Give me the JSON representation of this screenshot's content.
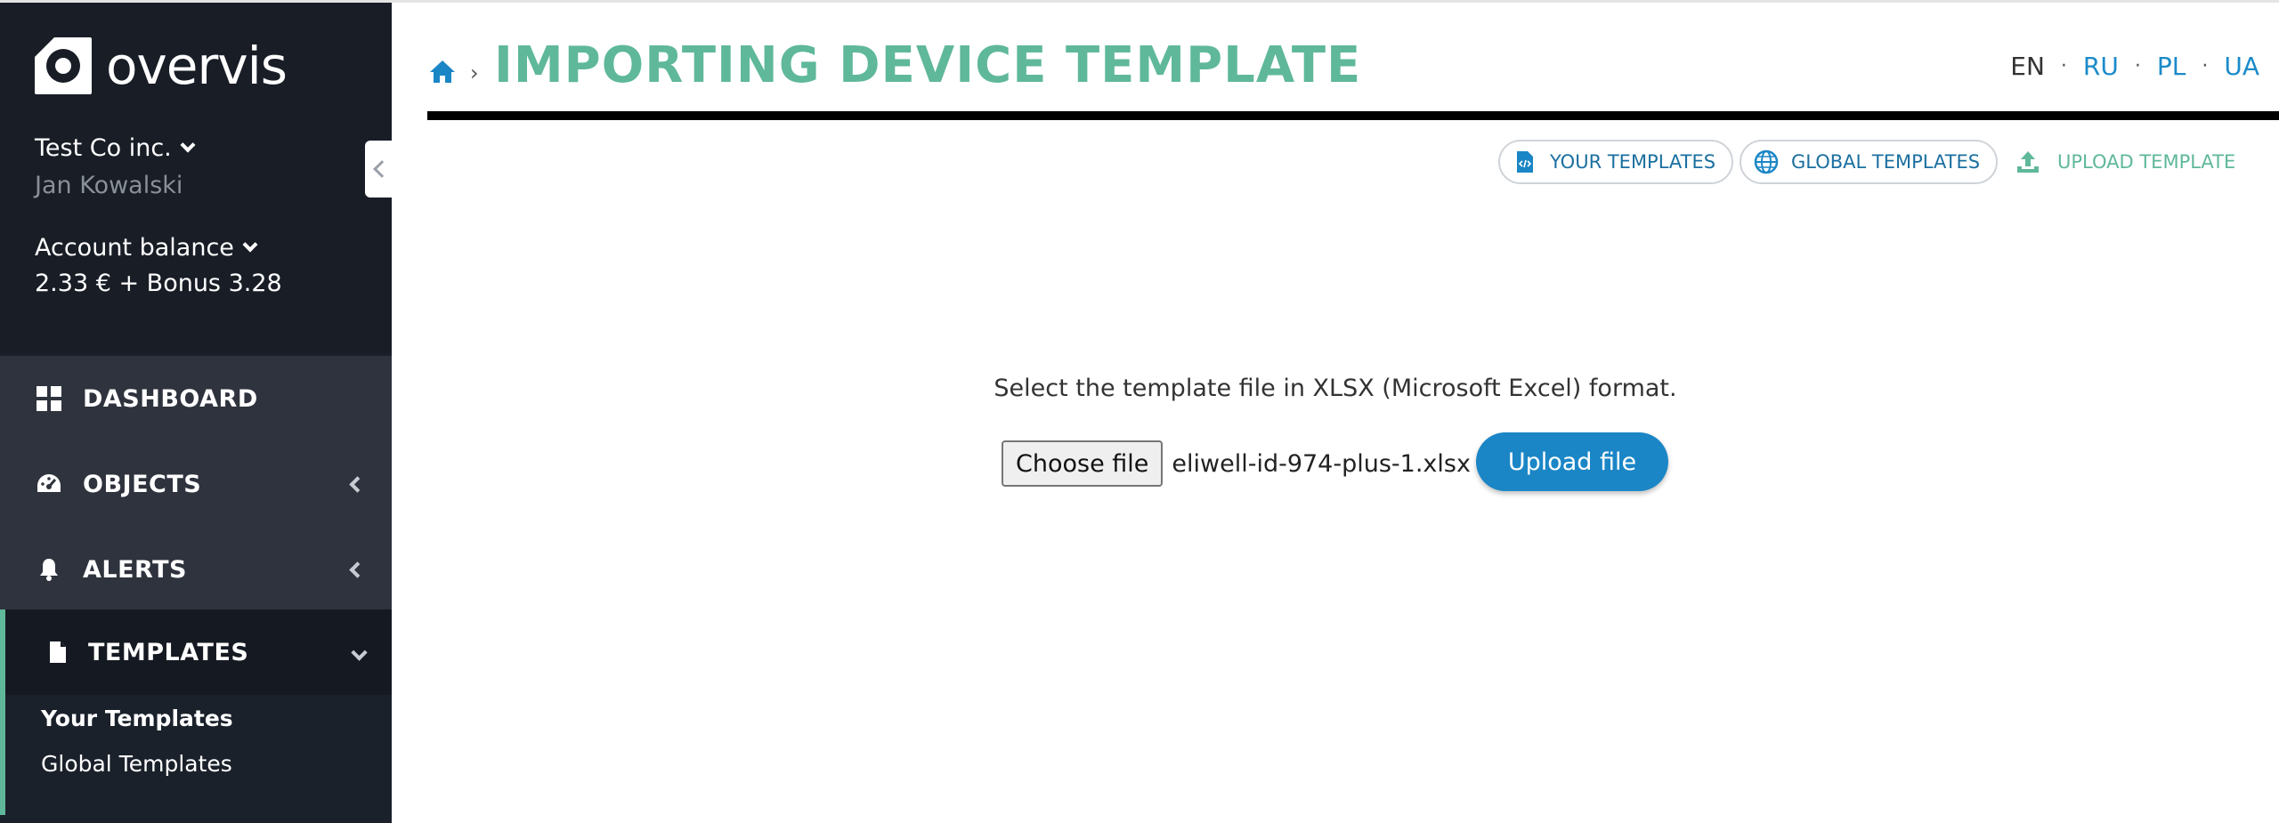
{
  "brand": {
    "name": "overvis"
  },
  "account": {
    "company": "Test Co inc.",
    "user": "Jan Kowalski",
    "balance_label": "Account balance",
    "balance_value": "2.33 € + Bonus 3.28"
  },
  "sidebar": {
    "items": [
      {
        "label": "DASHBOARD",
        "icon": "dashboard-grid-icon"
      },
      {
        "label": "OBJECTS",
        "icon": "gauge-icon"
      },
      {
        "label": "ALERTS",
        "icon": "bell-icon"
      },
      {
        "label": "TEMPLATES",
        "icon": "file-icon",
        "active": true
      }
    ],
    "submenu": [
      {
        "label": "Your Templates",
        "current": true
      },
      {
        "label": "Global Templates"
      }
    ]
  },
  "header": {
    "breadcrumb_sep": "›",
    "title": "IMPORTING DEVICE TEMPLATE"
  },
  "languages": [
    "EN",
    "RU",
    "PL",
    "UA"
  ],
  "current_language": "EN",
  "toolbar": {
    "your_templates": "YOUR TEMPLATES",
    "global_templates": "GLOBAL TEMPLATES",
    "upload_template": "UPLOAD TEMPLATE"
  },
  "upload": {
    "instruction": "Select the template file in XLSX (Microsoft Excel) format.",
    "choose_label": "Choose file",
    "file_name": "eliwell-id-974-plus-1.xlsx",
    "submit_label": "Upload file"
  },
  "colors": {
    "accent": "#5fb89a",
    "link": "#1b8bc9",
    "primary_button": "#1b86c6",
    "sidebar_bg": "#1b212b"
  }
}
